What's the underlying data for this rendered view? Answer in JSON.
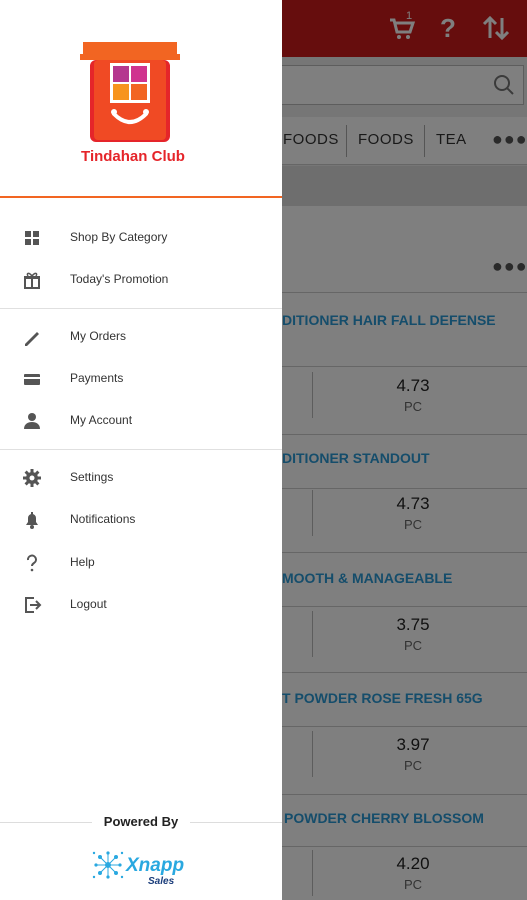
{
  "drawer": {
    "brand_name": "Tindahan Club",
    "menu_groups": [
      [
        {
          "label": "Shop By Category",
          "icon": "grid-icon"
        },
        {
          "label": "Today's Promotion",
          "icon": "gift-icon"
        }
      ],
      [
        {
          "label": "My Orders",
          "icon": "pencil-icon"
        },
        {
          "label": "Payments",
          "icon": "credit-card-icon"
        },
        {
          "label": "My Account",
          "icon": "person-icon"
        }
      ],
      [
        {
          "label": "Settings",
          "icon": "gear-icon"
        },
        {
          "label": "Notifications",
          "icon": "bell-icon"
        },
        {
          "label": "Help",
          "icon": "question-icon"
        },
        {
          "label": "Logout",
          "icon": "logout-icon"
        }
      ]
    ],
    "powered_by": "Powered By",
    "vendor_logo_text": "Xnapp",
    "vendor_logo_subtext": "Sales"
  },
  "background": {
    "cart_badge": "1",
    "category_tabs": [
      "FOODS",
      "FOODS",
      "TEA"
    ],
    "products": [
      {
        "name": "DITIONER HAIR FALL DEFENSE",
        "price": "4.73",
        "unit": "PC"
      },
      {
        "name": "DITIONER STANDOUT",
        "price": "4.73",
        "unit": "PC"
      },
      {
        "name": "MOOTH & MANAGEABLE",
        "price": "3.75",
        "unit": "PC"
      },
      {
        "name": "T POWDER ROSE FRESH 65G",
        "price": "3.97",
        "unit": "PC"
      },
      {
        "name": "POWDER CHERRY BLOSSOM",
        "price": "4.20",
        "unit": "PC"
      }
    ]
  },
  "colors": {
    "brand_red": "#e5252a",
    "toolbar_red": "#cc1b1b",
    "accent_orange": "#f26522",
    "link_blue": "#2b9ad6"
  }
}
